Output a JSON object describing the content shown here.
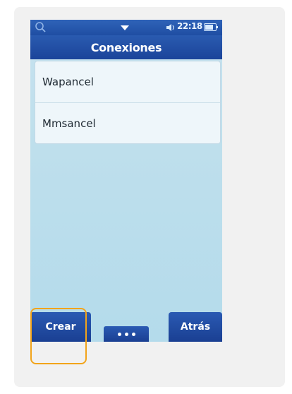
{
  "status_bar": {
    "time": "22:18",
    "icons": [
      "search-icon",
      "dropdown-arrow-icon",
      "sound-icon",
      "battery-icon"
    ],
    "battery_level": 0.8
  },
  "header": {
    "title": "Conexiones"
  },
  "connections": [
    {
      "label": "Wapancel"
    },
    {
      "label": "Mmsancel"
    }
  ],
  "softkeys": {
    "left_label": "Crear",
    "right_label": "Atrás",
    "more_icon": "more-dots-icon"
  },
  "colors": {
    "accent": "#1f4ea3",
    "background": "#bfdfec",
    "highlight": "#f2a41a"
  }
}
